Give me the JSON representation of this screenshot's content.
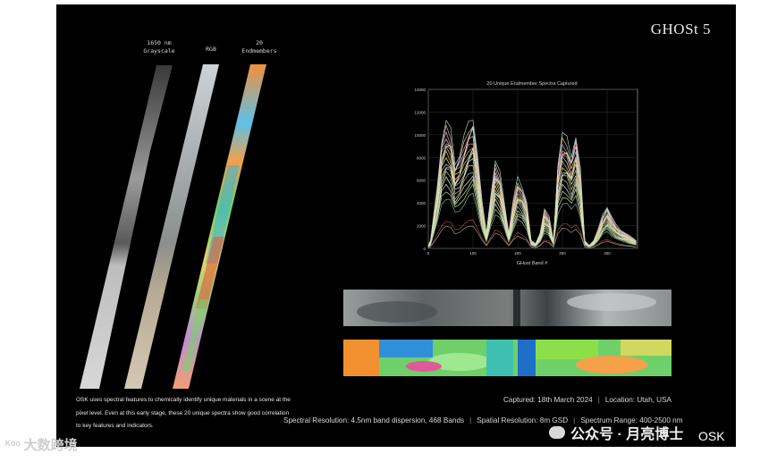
{
  "brand": "GHOSt 5",
  "strips": {
    "grayscale_label": "1650 nm\nGrayscale",
    "rgb_label": "RGB",
    "endmembers_label": "20\nEndmembers"
  },
  "chart_data": {
    "type": "line",
    "title": "20 Unique Endmember Spectra Captured",
    "xlabel": "GHost Band #",
    "ylabel": "",
    "xlim": [
      0,
      468
    ],
    "ylim": [
      0,
      14000
    ],
    "xticks": [
      0,
      100,
      200,
      300,
      400
    ],
    "yticks": [
      0,
      2000,
      4000,
      6000,
      8000,
      10000,
      12000,
      14000
    ],
    "grid": true,
    "profile_x": [
      0,
      5,
      20,
      30,
      40,
      50,
      60,
      70,
      80,
      90,
      100,
      110,
      120,
      130,
      140,
      150,
      160,
      170,
      180,
      190,
      200,
      210,
      220,
      230,
      240,
      250,
      260,
      270,
      280,
      290,
      300,
      310,
      320,
      330,
      340,
      350,
      360,
      370,
      380,
      390,
      400,
      410,
      420,
      430,
      440,
      450,
      460,
      465
    ],
    "profile": [
      0.02,
      0.05,
      0.4,
      0.7,
      0.8,
      0.75,
      0.55,
      0.6,
      0.7,
      0.8,
      0.85,
      0.6,
      0.3,
      0.1,
      0.35,
      0.55,
      0.48,
      0.3,
      0.1,
      0.3,
      0.45,
      0.4,
      0.3,
      0.05,
      0.03,
      0.1,
      0.25,
      0.2,
      0.05,
      0.55,
      0.72,
      0.7,
      0.6,
      0.72,
      0.5,
      0.05,
      0.02,
      0.05,
      0.12,
      0.22,
      0.27,
      0.2,
      0.15,
      0.12,
      0.1,
      0.08,
      0.06,
      0.05
    ],
    "series": [
      {
        "peak": 13800,
        "color": "#9fd8c8"
      },
      {
        "peak": 13000,
        "color": "#f2c08a"
      },
      {
        "peak": 12500,
        "color": "#d7a5e6"
      },
      {
        "peak": 12200,
        "color": "#ffd6d6"
      },
      {
        "peak": 12000,
        "color": "#a9c7f2"
      },
      {
        "peak": 11600,
        "color": "#f7f08a"
      },
      {
        "peak": 11200,
        "color": "#f0a8c8"
      },
      {
        "peak": 10800,
        "color": "#c8e6a0"
      },
      {
        "peak": 10400,
        "color": "#e8d27a"
      },
      {
        "peak": 10000,
        "color": "#ffe9a8"
      },
      {
        "peak": 9600,
        "color": "#b8e0e8"
      },
      {
        "peak": 9200,
        "color": "#f5f5c0"
      },
      {
        "peak": 8800,
        "color": "#e6c8a0"
      },
      {
        "peak": 8200,
        "color": "#a0d0b0"
      },
      {
        "peak": 7600,
        "color": "#ffeebb"
      },
      {
        "peak": 7000,
        "color": "#d0f0d0"
      },
      {
        "peak": 6400,
        "color": "#c6e88a"
      },
      {
        "peak": 5600,
        "color": "#7fb0a0"
      },
      {
        "peak": 3000,
        "color": "#b04a3a"
      },
      {
        "peak": 2400,
        "color": "#9a9a9a"
      }
    ]
  },
  "caption": "OSK uses spectral features to chemically identify unique materials in a scene at the pixel level. Even at this early stage, these 20 unique spectra show good correlation to key features and indicators.",
  "meta": {
    "captured": "Captured: 18th March 2024",
    "location": "Location: Utah, USA",
    "spectral": "Spectral Resolution: 4.5nm band dispersion, 468 Bands",
    "spatial": "Spatial Resolution: 8m GSD",
    "range": "Spectrum Range: 400-2500 nm"
  },
  "watermark": {
    "left": "大数跨境",
    "right": "公众号 · 月亮博士",
    "osk": "OSK"
  }
}
